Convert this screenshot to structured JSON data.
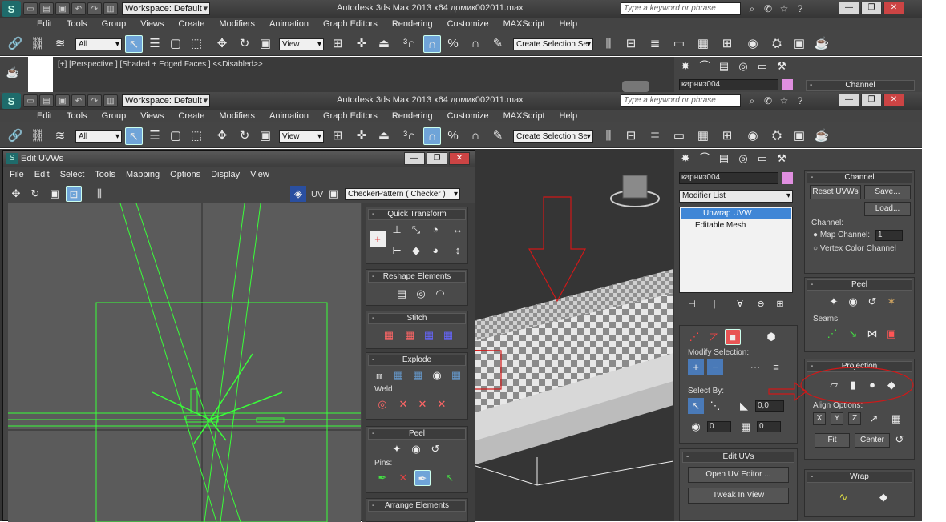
{
  "back_window": {
    "title": "Autodesk 3ds Max  2013 x64     домик002011.max",
    "workspace": "Workspace: Default",
    "search_placeholder": "Type a keyword or phrase",
    "menu": [
      "Edit",
      "Tools",
      "Group",
      "Views",
      "Create",
      "Modifiers",
      "Animation",
      "Graph Editors",
      "Rendering",
      "Customize",
      "MAXScript",
      "Help"
    ],
    "filter": "All",
    "ref_coord": "View",
    "selection_set": "Create Selection Se",
    "viewport_label": "[+] [Perspective ] [Shaded + Edged Faces ]  <<Disabled>>",
    "object_name": "карниз004",
    "rollout_channel": "Channel"
  },
  "front_window": {
    "title": "Autodesk 3ds Max  2013 x64     домик002011.max",
    "workspace": "Workspace: Default",
    "search_placeholder": "Type a keyword or phrase",
    "menu": [
      "Edit",
      "Tools",
      "Group",
      "Views",
      "Create",
      "Modifiers",
      "Animation",
      "Graph Editors",
      "Rendering",
      "Customize",
      "MAXScript",
      "Help"
    ],
    "filter": "All",
    "ref_coord": "View",
    "selection_set": "Create Selection Se"
  },
  "command_panel": {
    "object_name": "карниз004",
    "modifier_list": "Modifier List",
    "stack": [
      "Unwrap UVW",
      "Editable Mesh"
    ],
    "modify_selection": "Modify Selection:",
    "select_by": "Select By:",
    "spin_values": [
      "0,0",
      "0",
      "0"
    ],
    "edit_uvs": "Edit UVs",
    "open_uv_editor": "Open UV Editor ...",
    "tweak_in_view": "Tweak In View",
    "channel": {
      "header": "Channel",
      "reset": "Reset UVWs",
      "save": "Save...",
      "load": "Load...",
      "channel_label": "Channel:",
      "map_channel": "Map Channel:",
      "map_channel_value": "1",
      "vertex_color": "Vertex Color Channel"
    },
    "peel": {
      "header": "Peel",
      "seams": "Seams:"
    },
    "projection": {
      "header": "Projection",
      "align": "Align Options:",
      "x": "X",
      "y": "Y",
      "z": "Z",
      "fit": "Fit",
      "center": "Center"
    },
    "wrap": {
      "header": "Wrap"
    }
  },
  "uv_editor": {
    "title": "Edit UVWs",
    "menu": [
      "File",
      "Edit",
      "Select",
      "Tools",
      "Mapping",
      "Options",
      "Display",
      "View"
    ],
    "uv_label": "UV",
    "texture": "CheckerPattern  ( Checker )",
    "quick_transform": "Quick Transform",
    "reshape": "Reshape Elements",
    "stitch": "Stitch",
    "explode": "Explode",
    "weld": "Weld",
    "peel": "Peel",
    "pins": "Pins:",
    "arrange": "Arrange Elements"
  },
  "colors": {
    "accent": "#6fa4d8",
    "uv_green": "#39ff39",
    "annotation_red": "#d01818",
    "viewport_bg": "#353535"
  }
}
